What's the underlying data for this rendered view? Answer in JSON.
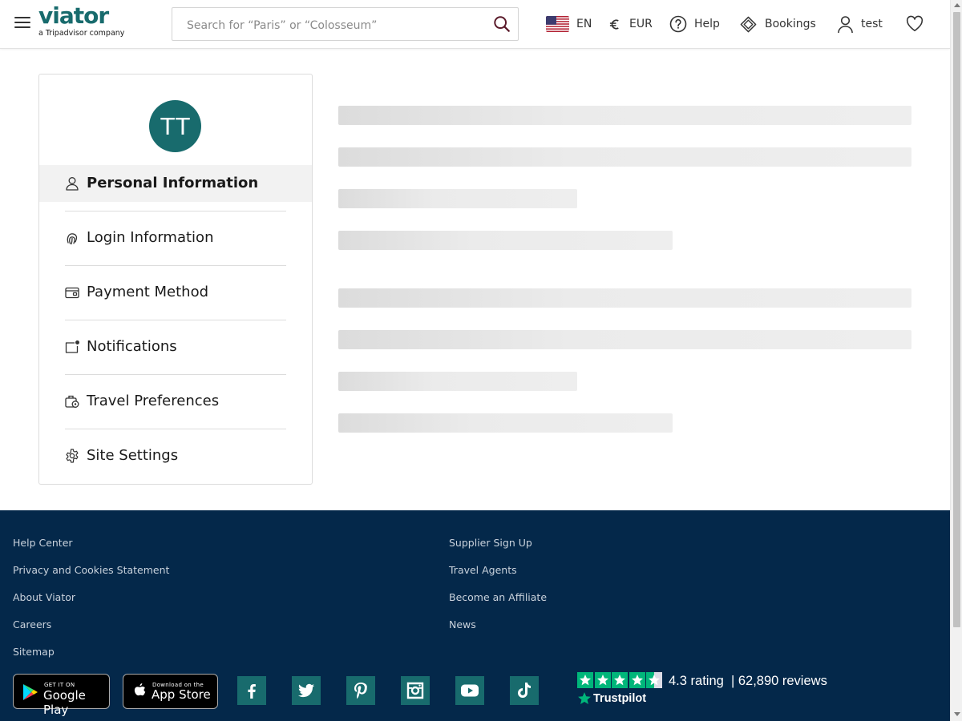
{
  "header": {
    "logo": {
      "brand": "viator",
      "tagline": "a Tripadvisor company"
    },
    "search_placeholder": "Search for “Paris” or “Colosseum”",
    "language": "EN",
    "currency": "EUR",
    "help": "Help",
    "bookings": "Bookings",
    "user": "test"
  },
  "profile": {
    "avatar_initials": "TT",
    "menu": [
      {
        "label": "Personal Information",
        "icon": "person-icon",
        "active": true
      },
      {
        "label": "Login Information",
        "icon": "fingerprint-icon"
      },
      {
        "label": "Payment Method",
        "icon": "wallet-icon"
      },
      {
        "label": "Notifications",
        "icon": "notification-icon"
      },
      {
        "label": "Travel Preferences",
        "icon": "luggage-icon"
      },
      {
        "label": "Site Settings",
        "icon": "gear-icon"
      }
    ]
  },
  "footer": {
    "links_left": [
      "Help Center",
      "Privacy and Cookies Statement",
      "About Viator",
      "Careers",
      "Sitemap"
    ],
    "links_right": [
      "Supplier Sign Up",
      "Travel Agents",
      "Become an Affiliate",
      "News"
    ],
    "google_play": {
      "small": "GET IT ON",
      "big": "Google Play"
    },
    "app_store": {
      "small": "Download on the",
      "big": "App Store"
    },
    "social": [
      "facebook-icon",
      "twitter-icon",
      "pinterest-icon",
      "instagram-icon",
      "youtube-icon",
      "tiktok-icon"
    ],
    "trustpilot": {
      "rating_text": "4.3 rating",
      "reviews_text": "| 62,890 reviews",
      "brand": "Trustpilot",
      "stars": 4.3
    }
  },
  "colors": {
    "brand": "#186b6d",
    "footer_bg": "#04284a",
    "trustpilot_green": "#00b67a"
  }
}
